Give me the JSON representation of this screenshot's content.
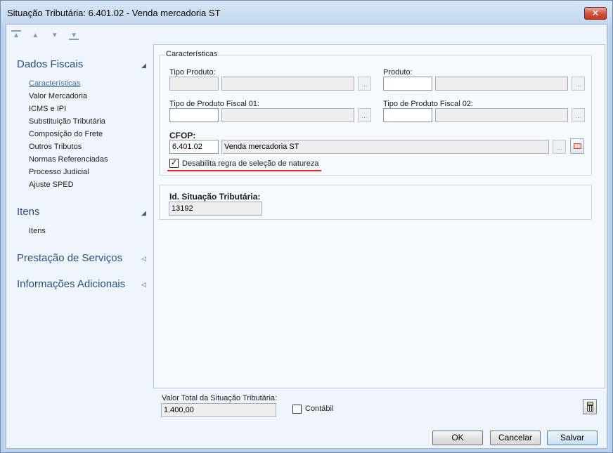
{
  "window": {
    "title": "Situação Tributária: 6.401.02 - Venda mercadoria ST",
    "close_label": "✕"
  },
  "toolbar": {
    "first_icon": "▲",
    "prev_icon": "▲",
    "next_icon": "▼",
    "last_icon": "▼"
  },
  "sidebar": {
    "groups": [
      {
        "title": "Dados Fiscais",
        "arrow": "◢"
      },
      {
        "title": "Itens",
        "arrow": "◢"
      },
      {
        "title": "Prestação de Serviços",
        "arrow": "◁"
      },
      {
        "title": "Informações Adicionais",
        "arrow": "◁"
      }
    ],
    "dados_fiscais_items": [
      "Características",
      "Valor Mercadoria",
      "ICMS e IPI",
      "Substituição Tributária",
      "Composição do Frete",
      "Outros Tributos",
      "Normas Referenciadas",
      "Processo Judicial",
      "Ajuste SPED"
    ],
    "itens_items": [
      "Itens"
    ]
  },
  "caracteristicas": {
    "legend": "Características",
    "tipo_produto_label": "Tipo Produto:",
    "tipo_produto_code": "",
    "tipo_produto_desc": "",
    "produto_label": "Produto:",
    "produto_code": "",
    "produto_desc": "",
    "tipo_fiscal_01_label": "Tipo de Produto Fiscal 01:",
    "tipo_fiscal_01_code": "",
    "tipo_fiscal_01_desc": "",
    "tipo_fiscal_02_label": "Tipo de Produto Fiscal 02:",
    "tipo_fiscal_02_code": "",
    "tipo_fiscal_02_desc": "",
    "cfop_label": "CFOP:",
    "cfop_code": "6.401.02",
    "cfop_desc": "Venda mercadoria ST",
    "browse_label": "...",
    "disable_rule_label": "Desabilita regra de seleção de natureza",
    "disable_rule_checked": true,
    "check_glyph": "✓"
  },
  "situacao": {
    "id_label": "Id. Situação Tributária:",
    "id_value": "13192"
  },
  "footer": {
    "valor_total_label": "Valor Total da Situação Tributária:",
    "valor_total_value": "1.400,00",
    "contabil_label": "Contábil",
    "contabil_checked": false,
    "ok_label": "OK",
    "cancel_label": "Cancelar",
    "save_label": "Salvar"
  },
  "colors": {
    "accent_red": "#e0261e",
    "group_title": "#2d4e7f",
    "link_active": "#4a6a96"
  }
}
